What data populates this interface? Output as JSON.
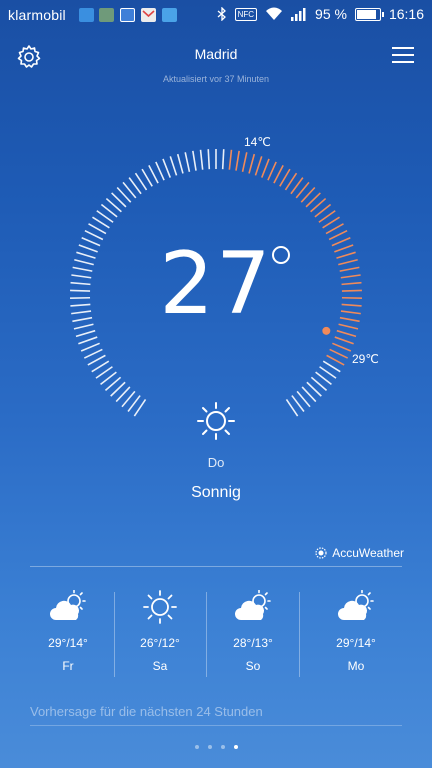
{
  "status_bar": {
    "carrier": "klarmobil",
    "battery_text": "95 %",
    "battery_level": 0.95,
    "time": "16:16",
    "notification_icons": [
      "blue-app-icon",
      "photo-app-icon",
      "image-app-icon",
      "gmail-icon",
      "twitter-icon"
    ],
    "system_icons": [
      "bluetooth-icon",
      "nfc-icon",
      "wifi-icon",
      "signal-icon",
      "battery-icon"
    ],
    "nfc_label": "NFC"
  },
  "header": {
    "city": "Madrid",
    "updated": "Aktualisiert vor 37 Minuten"
  },
  "current": {
    "temperature": "27",
    "low_label": "14℃",
    "high_label": "29℃",
    "day": "Do",
    "condition": "Sonnig",
    "condition_icon": "sun-icon"
  },
  "provider": {
    "name": "AccuWeather"
  },
  "forecast": [
    {
      "temps": "29°/14°",
      "day": "Fr",
      "icon": "partly-cloudy-icon"
    },
    {
      "temps": "26°/12°",
      "day": "Sa",
      "icon": "sun-icon"
    },
    {
      "temps": "28°/13°",
      "day": "So",
      "icon": "partly-cloudy-icon"
    },
    {
      "temps": "29°/14°",
      "day": "Mo",
      "icon": "partly-cloudy-icon"
    }
  ],
  "forecast24_label": "Vorhersage für die nächsten 24 Stunden",
  "pager": {
    "count": 4,
    "active": 4
  },
  "colors": {
    "accent": "#f08a5a",
    "background_top": "#1a4fa4",
    "background_bottom": "#4a8cd9"
  }
}
